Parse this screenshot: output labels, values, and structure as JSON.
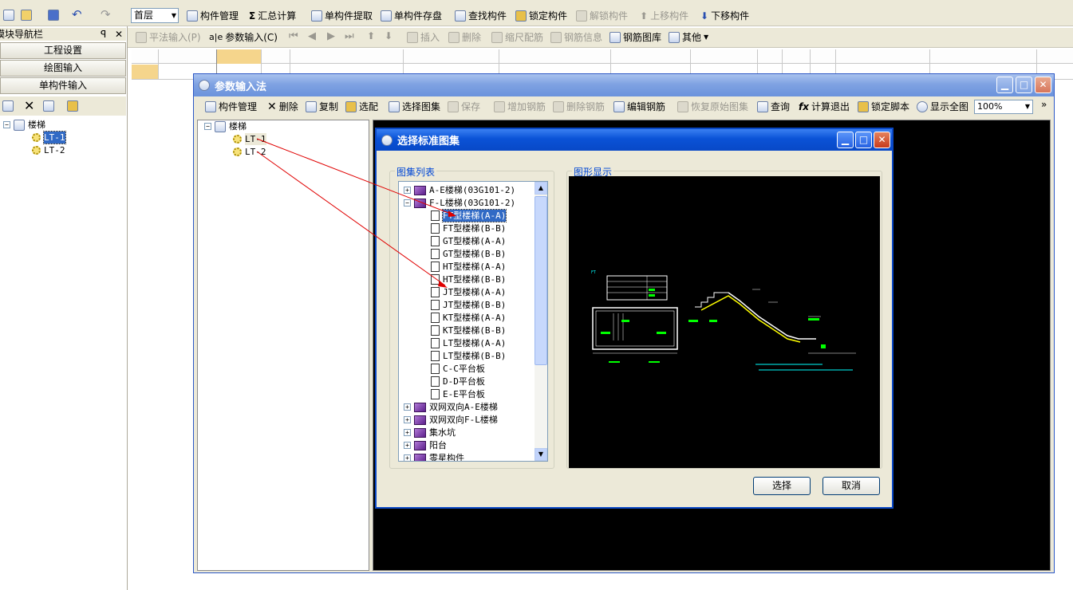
{
  "toolbar1": {
    "floor": "首层",
    "component_mgmt": "构件管理",
    "sum_calc": "汇总计算",
    "single_extract": "单构件提取",
    "single_save": "单构件存盘",
    "find": "查找构件",
    "lock": "锁定构件",
    "unlock": "解锁构件",
    "move_up": "上移构件",
    "move_down": "下移构件"
  },
  "nav": {
    "title": "模块导航栏",
    "pin": "ꟼ",
    "close": "✕",
    "project_settings": "工程设置",
    "drawing_input": "绘图输入",
    "single_input": "单构件输入",
    "tree_root": "楼梯",
    "items": [
      "LT-1",
      "LT-2"
    ]
  },
  "toolbar2": {
    "plan_input": "平法输入(P)",
    "param_input": "参数输入(C)",
    "insert": "插入",
    "delete": "删除",
    "scale": "缩尺配筋",
    "rebar_info": "钢筋信息",
    "rebar_lib": "钢筋图库",
    "other": "其他"
  },
  "param_window": {
    "title": "参数输入法",
    "component_mgmt": "构件管理",
    "delete": "删除",
    "copy": "复制",
    "pick": "选配",
    "select_atlas": "选择图集",
    "save": "保存",
    "add_rebar": "增加钢筋",
    "del_rebar": "删除钢筋",
    "edit_rebar": "编辑钢筋",
    "restore": "恢复原始图集",
    "query": "查询",
    "calc_exit": "计算退出",
    "lock_script": "锁定脚本",
    "show_all": "显示全图",
    "zoom": "100%",
    "more": "»",
    "tree_root": "楼梯",
    "items": [
      "LT-1",
      "LT-2"
    ]
  },
  "dialog": {
    "title": "选择标准图集",
    "list_label": "图集列表",
    "graph_label": "图形显示",
    "select_btn": "选择",
    "cancel_btn": "取消",
    "tree": [
      {
        "type": "book",
        "label": "A-E楼梯(03G101-2)",
        "exp": "+"
      },
      {
        "type": "book",
        "label": "F-L楼梯(03G101-2)",
        "exp": "-"
      },
      {
        "type": "doc",
        "label": "FT型楼梯(A-A)",
        "sel": true
      },
      {
        "type": "doc",
        "label": "FT型楼梯(B-B)"
      },
      {
        "type": "doc",
        "label": "GT型楼梯(A-A)"
      },
      {
        "type": "doc",
        "label": "GT型楼梯(B-B)"
      },
      {
        "type": "doc",
        "label": "HT型楼梯(A-A)"
      },
      {
        "type": "doc",
        "label": "HT型楼梯(B-B)"
      },
      {
        "type": "doc",
        "label": "JT型楼梯(A-A)"
      },
      {
        "type": "doc",
        "label": "JT型楼梯(B-B)"
      },
      {
        "type": "doc",
        "label": "KT型楼梯(A-A)"
      },
      {
        "type": "doc",
        "label": "KT型楼梯(B-B)"
      },
      {
        "type": "doc",
        "label": "LT型楼梯(A-A)"
      },
      {
        "type": "doc",
        "label": "LT型楼梯(B-B)"
      },
      {
        "type": "doc",
        "label": "C-C平台板"
      },
      {
        "type": "doc",
        "label": "D-D平台板"
      },
      {
        "type": "doc",
        "label": "E-E平台板"
      },
      {
        "type": "book",
        "label": "双网双向A-E楼梯",
        "exp": "+"
      },
      {
        "type": "book",
        "label": "双网双向F-L楼梯",
        "exp": "+"
      },
      {
        "type": "book",
        "label": "集水坑",
        "exp": "+"
      },
      {
        "type": "book",
        "label": "阳台",
        "exp": "+"
      },
      {
        "type": "book",
        "label": "零星构件",
        "exp": "+"
      }
    ]
  },
  "colors": {
    "title_blue": "#0a52d6",
    "cad_black": "#000000",
    "arrow_red": "#e00000",
    "cad_yellow": "#ffff00",
    "cad_green": "#00ff00",
    "cad_cyan": "#00ffff"
  }
}
